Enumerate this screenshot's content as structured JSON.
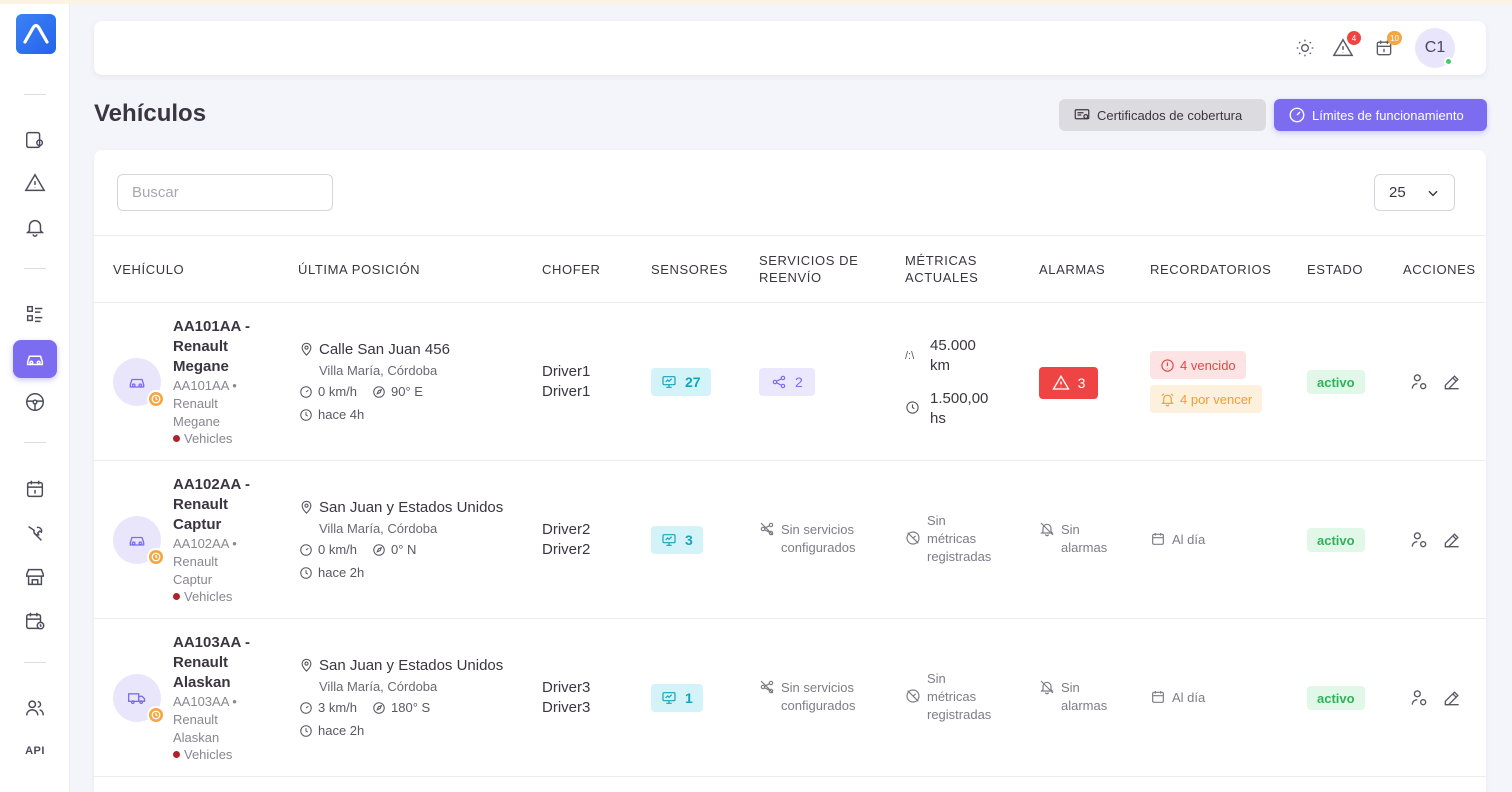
{
  "page": {
    "title": "Vehículos"
  },
  "header": {
    "alerts_badge": "4",
    "calendar_badge": "10",
    "avatar_initials": "C1"
  },
  "buttons": {
    "certificates": "Certificados de cobertura",
    "limits": "Límites de funcionamiento"
  },
  "toolbar": {
    "search_placeholder": "Buscar",
    "page_size": "25"
  },
  "sidebar": {
    "api_label": "API"
  },
  "columns": {
    "vehicle": "VEHÍCULO",
    "position": "ÚLTIMA POSICIÓN",
    "driver": "CHOFER",
    "sensors": "SENSORES",
    "forwarding_1": "SERVICIOS DE",
    "forwarding_2": "REENVÍO",
    "metrics_1": "MÉTRICAS",
    "metrics_2": "ACTUALES",
    "alarms": "ALARMAS",
    "reminders": "RECORDATORIOS",
    "status": "ESTADO",
    "actions": "ACCIONES"
  },
  "rows": [
    {
      "title_l1": "AA101AA -",
      "title_l2": "Renault",
      "title_l3": "Megane",
      "sub_l1": "AA101AA •",
      "sub_l2": "Renault",
      "sub_l3": "Megane",
      "group": "Vehicles",
      "address": "Calle San Juan 456",
      "city": "Villa María, Córdoba",
      "speed": "0 km/h",
      "heading": "90° E",
      "time": "hace 4h",
      "driver_l1": "Driver1",
      "driver_l2": "Driver1",
      "sensors": "27",
      "forwarding": "2",
      "metric_km_l1": "45.000",
      "metric_km_l2": "km",
      "metric_hs_l1": "1.500,00",
      "metric_hs_l2": "hs",
      "alarms": "3",
      "reminder_overdue": "4 vencido",
      "reminder_upcoming": "4 por vencer",
      "status": "activo"
    },
    {
      "title_l1": "AA102AA -",
      "title_l2": "Renault",
      "title_l3": "Captur",
      "sub_l1": "AA102AA •",
      "sub_l2": "Renault",
      "sub_l3": "Captur",
      "group": "Vehicles",
      "address": "San Juan y Estados Unidos",
      "city": "Villa María, Córdoba",
      "speed": "0 km/h",
      "heading": "0° N",
      "time": "hace 2h",
      "driver_l1": "Driver2",
      "driver_l2": "Driver2",
      "sensors": "3",
      "forwarding_l1": "Sin servicios",
      "forwarding_l2": "configurados",
      "metrics_l1": "Sin",
      "metrics_l2": "métricas",
      "metrics_l3": "registradas",
      "alarms_l1": "Sin",
      "alarms_l2": "alarmas",
      "reminders": "Al día",
      "status": "activo"
    },
    {
      "title_l1": "AA103AA -",
      "title_l2": "Renault",
      "title_l3": "Alaskan",
      "sub_l1": "AA103AA •",
      "sub_l2": "Renault",
      "sub_l3": "Alaskan",
      "group": "Vehicles",
      "address": "San Juan y Estados Unidos",
      "city": "Villa María, Córdoba",
      "speed": "3 km/h",
      "heading": "180° S",
      "time": "hace 2h",
      "driver_l1": "Driver3",
      "driver_l2": "Driver3",
      "sensors": "1",
      "forwarding_l1": "Sin servicios",
      "forwarding_l2": "configurados",
      "metrics_l1": "Sin",
      "metrics_l2": "métricas",
      "metrics_l3": "registradas",
      "alarms_l1": "Sin",
      "alarms_l2": "alarmas",
      "reminders": "Al día",
      "status": "activo"
    }
  ],
  "colors": {
    "primary": "#7c6cf0",
    "danger": "#ef4444",
    "success": "#2fb35a",
    "info": "#16a3bb",
    "warning": "#f5a742"
  },
  "icons": {
    "sidebar": [
      "map-pin-screen-icon",
      "alert-triangle-icon",
      "bell-icon",
      "checklist-icon",
      "car-icon",
      "steering-wheel-icon",
      "calendar-icon",
      "wrench-icon",
      "store-icon",
      "calendar-clock-icon",
      "users-icon"
    ],
    "header": [
      "sun-icon",
      "alert-triangle-icon",
      "calendar-icon"
    ]
  }
}
